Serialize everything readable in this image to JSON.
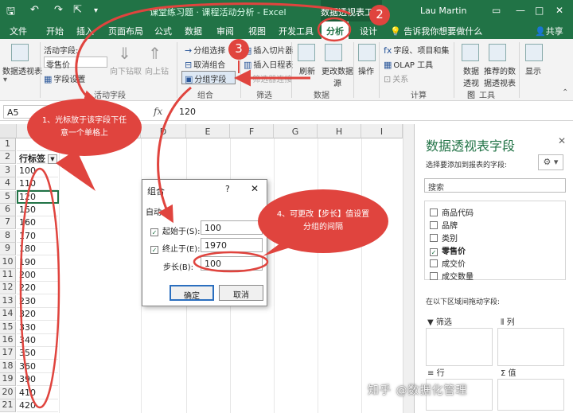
{
  "titlebar": {
    "doc_title": "课堂练习题 · 课程活动分析 - Excel",
    "context_tab": "数据透视表工具",
    "user": "Lau Martin"
  },
  "tabs": [
    "文件",
    "开始",
    "插入",
    "页面布局",
    "公式",
    "数据",
    "审阅",
    "视图",
    "开发工具",
    "分析",
    "设计"
  ],
  "active_tab": "分析",
  "tell_me": "告诉我你想要做什么",
  "share": "共享",
  "ribbon": {
    "pivot_table": "数据透视表",
    "active_field_label": "活动字段:",
    "active_field_value": "零售价",
    "field_settings": "字段设置",
    "drill_down": "向下钻取",
    "drill_up": "向上钻",
    "group_active_field": "活动字段",
    "group_selection": "分组选择",
    "ungroup": "取消组合",
    "group_field": "分组字段",
    "group_group": "组合",
    "insert_slicer": "插入切片器",
    "insert_timeline": "插入日程表",
    "filter_connections": "筛选器连接",
    "group_filter": "筛选",
    "refresh": "刷新",
    "change_source": "更改数据源",
    "group_data": "数据",
    "actions": "操作",
    "fields_items": "字段、项目和集",
    "olap_tools": "OLAP 工具",
    "relationships": "关系",
    "group_calc": "计算",
    "pivot_chart": "数据透视图",
    "recommended": "推荐的数据透视表",
    "group_tools": "工具",
    "show": "显示"
  },
  "formula_bar": {
    "name_box": "A5",
    "fx": "fx",
    "value": "120"
  },
  "columns": [
    "A",
    "D",
    "E",
    "F",
    "G",
    "H",
    "I"
  ],
  "rows": [
    "1",
    "2",
    "3",
    "4",
    "5",
    "6",
    "7",
    "8",
    "9",
    "10",
    "11",
    "12",
    "13",
    "14",
    "15",
    "16",
    "17",
    "18",
    "19",
    "20",
    "21"
  ],
  "cells": [
    "",
    "行标签",
    "100",
    "110",
    "120",
    "150",
    "160",
    "170",
    "180",
    "190",
    "200",
    "220",
    "230",
    "320",
    "330",
    "340",
    "350",
    "360",
    "390",
    "410",
    "420"
  ],
  "dialog": {
    "title": "组合",
    "help": "?",
    "close": "✕",
    "auto": "自动",
    "start_label": "起始于(S):",
    "start_value": "100",
    "end_label": "终止于(E):",
    "end_value": "1970",
    "step_label": "步长(B):",
    "step_value": "100",
    "ok": "确定",
    "cancel": "取消"
  },
  "pane": {
    "title": "数据透视表字段",
    "subtitle": "选择要添加到报表的字段:",
    "search": "搜索",
    "fields": [
      {
        "label": "商品代码",
        "checked": false
      },
      {
        "label": "品牌",
        "checked": false
      },
      {
        "label": "类别",
        "checked": false
      },
      {
        "label": "零售价",
        "checked": true
      },
      {
        "label": "成交价",
        "checked": false
      },
      {
        "label": "成交数量",
        "checked": false
      }
    ],
    "drag_note": "在以下区域间拖动字段:",
    "area_filter": "筛选",
    "area_columns": "列",
    "area_rows": "行",
    "area_values": "值"
  },
  "annotations": {
    "note1": "1、光标放于该字段下任意一个单格上",
    "note4": "4、可更改【步长】值设置分组的间隔",
    "badge2": "2",
    "badge3": "3"
  },
  "watermark": "知乎 @数据化管理"
}
